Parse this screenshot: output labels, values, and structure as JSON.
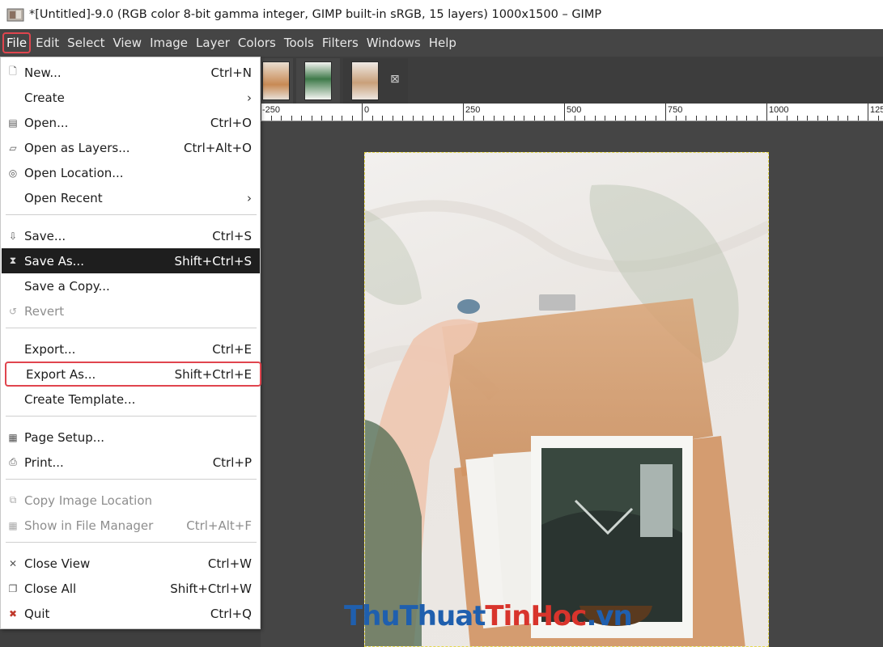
{
  "window": {
    "title": "*[Untitled]-9.0 (RGB color 8-bit gamma integer, GIMP built-in sRGB, 15 layers) 1000x1500 – GIMP"
  },
  "menubar": [
    "File",
    "Edit",
    "Select",
    "View",
    "Image",
    "Layer",
    "Colors",
    "Tools",
    "Filters",
    "Windows",
    "Help"
  ],
  "tabs": {
    "close_glyph": "⊠"
  },
  "ruler": {
    "labels": [
      "-250",
      "0",
      "250",
      "500",
      "750",
      "1000",
      "125"
    ]
  },
  "file_menu": {
    "items": [
      {
        "label": "New...",
        "shortcut": "Ctrl+N",
        "icon": "new-icon",
        "glyph": "🗋"
      },
      {
        "label": "Create",
        "shortcut": "",
        "icon": "",
        "glyph": "",
        "arrow": "›"
      },
      {
        "label": "Open...",
        "shortcut": "Ctrl+O",
        "icon": "open-icon",
        "glyph": "▤"
      },
      {
        "label": "Open as Layers...",
        "shortcut": "Ctrl+Alt+O",
        "icon": "open-layers-icon",
        "glyph": "▱"
      },
      {
        "label": "Open Location...",
        "shortcut": "",
        "icon": "globe-icon",
        "glyph": "◎"
      },
      {
        "label": "Open Recent",
        "shortcut": "",
        "icon": "",
        "glyph": "",
        "arrow": "›"
      },
      {
        "label": "Save...",
        "shortcut": "Ctrl+S",
        "icon": "save-icon",
        "glyph": "⇩"
      },
      {
        "label": "Save As...",
        "shortcut": "Shift+Ctrl+S",
        "icon": "save-as-icon",
        "glyph": "⧗"
      },
      {
        "label": "Save a Copy...",
        "shortcut": "",
        "icon": "",
        "glyph": ""
      },
      {
        "label": "Revert",
        "shortcut": "",
        "icon": "revert-icon",
        "glyph": "↺"
      },
      {
        "label": "Export...",
        "shortcut": "Ctrl+E",
        "icon": "",
        "glyph": ""
      },
      {
        "label": "Export As...",
        "shortcut": "Shift+Ctrl+E",
        "icon": "",
        "glyph": ""
      },
      {
        "label": "Create Template...",
        "shortcut": "",
        "icon": "",
        "glyph": ""
      },
      {
        "label": "Page Setup...",
        "shortcut": "",
        "icon": "page-setup-icon",
        "glyph": "▦"
      },
      {
        "label": "Print...",
        "shortcut": "Ctrl+P",
        "icon": "print-icon",
        "glyph": "⎙"
      },
      {
        "label": "Copy Image Location",
        "shortcut": "",
        "icon": "copy-location-icon",
        "glyph": "⧉"
      },
      {
        "label": "Show in File Manager",
        "shortcut": "Ctrl+Alt+F",
        "icon": "file-manager-icon",
        "glyph": "▦"
      },
      {
        "label": "Close View",
        "shortcut": "Ctrl+W",
        "icon": "close-view-icon",
        "glyph": "✕"
      },
      {
        "label": "Close All",
        "shortcut": "Shift+Ctrl+W",
        "icon": "close-all-icon",
        "glyph": "❐"
      },
      {
        "label": "Quit",
        "shortcut": "Ctrl+Q",
        "icon": "quit-icon",
        "glyph": "✖"
      }
    ]
  },
  "watermark": {
    "part1": "ThuThuat",
    "part2": "TinHoc",
    "part3": ".vn"
  },
  "colors": {
    "highlight_box": "#e0454e",
    "menu_selected_bg": "#1e1e1e",
    "watermark_blue": "#1f5fae",
    "watermark_red": "#d8342c"
  }
}
